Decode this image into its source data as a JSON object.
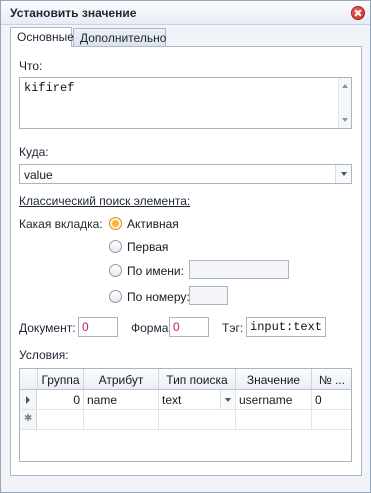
{
  "window": {
    "title": "Установить значение"
  },
  "tabs": [
    {
      "label": "Основные",
      "active": true
    },
    {
      "label": "Дополнительно",
      "active": false
    }
  ],
  "what": {
    "label": "Что:",
    "value": "kifiref"
  },
  "where": {
    "label": "Куда:",
    "value": "value"
  },
  "classic_search": {
    "heading": "Классический поиск элемента:",
    "tab_label": "Какая вкладка:",
    "options": [
      {
        "label": "Активная",
        "checked": true
      },
      {
        "label": "Первая",
        "checked": false
      },
      {
        "label": "По имени:",
        "checked": false
      },
      {
        "label": "По номеру:",
        "checked": false
      }
    ],
    "name_value": "",
    "number_value": ""
  },
  "document": {
    "label": "Документ:",
    "value": "0"
  },
  "form": {
    "label": "Форма:",
    "value": "0"
  },
  "tag": {
    "label": "Тэг:",
    "value": "input:text"
  },
  "conditions": {
    "label": "Условия:",
    "columns": [
      "Группа",
      "Атрибут",
      "Тип поиска",
      "Значение",
      "№ ..."
    ],
    "rows": [
      {
        "group": "0",
        "attribute": "name",
        "search_type": "text",
        "value": "username",
        "number": "0"
      }
    ]
  },
  "colors": {
    "accent_radio": "#ffb02e",
    "numeric_text": "#c0197a",
    "close": "#c82b20"
  },
  "icons": {
    "close": "close-icon",
    "row_current": "row-pointer-icon",
    "new_row": "new-row-icon"
  }
}
